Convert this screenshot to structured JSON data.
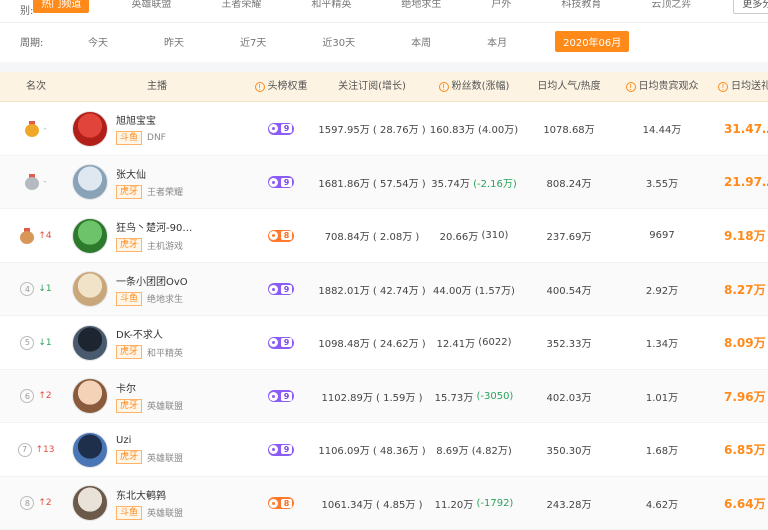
{
  "filters": {
    "category_label": "类别:",
    "categories": [
      "热门频道",
      "英雄联盟",
      "王者荣耀",
      "和平精英",
      "绝地求生",
      "户外",
      "科技教育",
      "云顶之弈"
    ],
    "more_label": "更多分类",
    "period_label": "周期:",
    "periods": [
      "今天",
      "昨天",
      "近7天",
      "近30天",
      "本周",
      "本月",
      "2020年06月"
    ],
    "active_period": "2020年06月"
  },
  "table": {
    "headers": {
      "rank": "名次",
      "anchor": "主播",
      "weight": "头榜权重",
      "follow": "关注订阅(增长)",
      "fans": "粉丝数(涨幅)",
      "popularity": "日均人气/热度",
      "viewers": "日均贵宾观众",
      "gift": "日均送礼"
    },
    "rows": [
      {
        "rank": "1",
        "medal": "gold",
        "change": "-",
        "change_dir": "same",
        "name": "旭旭宝宝",
        "platform": "斗鱼",
        "game": "DNF",
        "weight": "9",
        "weight_color": "purple",
        "follow": "1597.95万 ( 28.76万 )",
        "fans_val": "160.83万",
        "fans_delta": "(4.00万)",
        "fans_neg": false,
        "popularity": "1078.68万",
        "viewers": "14.44万",
        "gift": "31.47…"
      },
      {
        "rank": "2",
        "medal": "silver",
        "change": "-",
        "change_dir": "same",
        "name": "张大仙",
        "platform": "虎牙",
        "game": "王者荣耀",
        "weight": "9",
        "weight_color": "purple",
        "follow": "1681.86万 ( 57.54万 )",
        "fans_val": "35.74万",
        "fans_delta": "(-2.16万)",
        "fans_neg": true,
        "popularity": "808.24万",
        "viewers": "3.55万",
        "gift": "21.97…"
      },
      {
        "rank": "3",
        "medal": "bronze",
        "change": "4",
        "change_dir": "up",
        "name": "狂鸟丶楚河-90…",
        "platform": "虎牙",
        "game": "主机游戏",
        "weight": "8",
        "weight_color": "orange",
        "follow": "708.84万 ( 2.08万 )",
        "fans_val": "20.66万",
        "fans_delta": "(310)",
        "fans_neg": false,
        "popularity": "237.69万",
        "viewers": "9697",
        "gift": "9.18万"
      },
      {
        "rank": "4",
        "medal": "",
        "change": "1",
        "change_dir": "down",
        "name": "一条小团团OvO",
        "platform": "斗鱼",
        "game": "绝地求生",
        "weight": "9",
        "weight_color": "purple",
        "follow": "1882.01万 ( 42.74万 )",
        "fans_val": "44.00万",
        "fans_delta": "(1.57万)",
        "fans_neg": false,
        "popularity": "400.54万",
        "viewers": "2.92万",
        "gift": "8.27万"
      },
      {
        "rank": "5",
        "medal": "",
        "change": "1",
        "change_dir": "down",
        "name": "DK-不求人",
        "platform": "虎牙",
        "game": "和平精英",
        "weight": "9",
        "weight_color": "purple",
        "follow": "1098.48万 ( 24.62万 )",
        "fans_val": "12.41万",
        "fans_delta": "(6022)",
        "fans_neg": false,
        "popularity": "352.33万",
        "viewers": "1.34万",
        "gift": "8.09万"
      },
      {
        "rank": "6",
        "medal": "",
        "change": "2",
        "change_dir": "up",
        "name": "卡尔",
        "platform": "虎牙",
        "game": "英雄联盟",
        "weight": "9",
        "weight_color": "purple",
        "follow": "1102.89万 ( 1.59万 )",
        "fans_val": "15.73万",
        "fans_delta": "(-3050)",
        "fans_neg": true,
        "popularity": "402.03万",
        "viewers": "1.01万",
        "gift": "7.96万"
      },
      {
        "rank": "7",
        "medal": "",
        "change": "13",
        "change_dir": "up",
        "name": "Uzi",
        "platform": "虎牙",
        "game": "英雄联盟",
        "weight": "9",
        "weight_color": "purple",
        "follow": "1106.09万 ( 48.36万 )",
        "fans_val": "8.69万",
        "fans_delta": "(4.82万)",
        "fans_neg": false,
        "popularity": "350.30万",
        "viewers": "1.68万",
        "gift": "6.85万"
      },
      {
        "rank": "8",
        "medal": "",
        "change": "2",
        "change_dir": "up",
        "name": "东北大鹌鹑",
        "platform": "斗鱼",
        "game": "英雄联盟",
        "weight": "8",
        "weight_color": "orange",
        "follow": "1061.34万 ( 4.85万 )",
        "fans_val": "11.20万",
        "fans_delta": "(-1792)",
        "fans_neg": true,
        "popularity": "243.28万",
        "viewers": "4.62万",
        "gift": "6.64万"
      }
    ]
  },
  "colors": {
    "accent": "#ff8a1a",
    "purple_badge": "#8b5cf6",
    "orange_badge": "#ff7a2e",
    "header_bg": "#fdf3e3",
    "up": "#e84a3c",
    "down": "#2aa35a"
  }
}
